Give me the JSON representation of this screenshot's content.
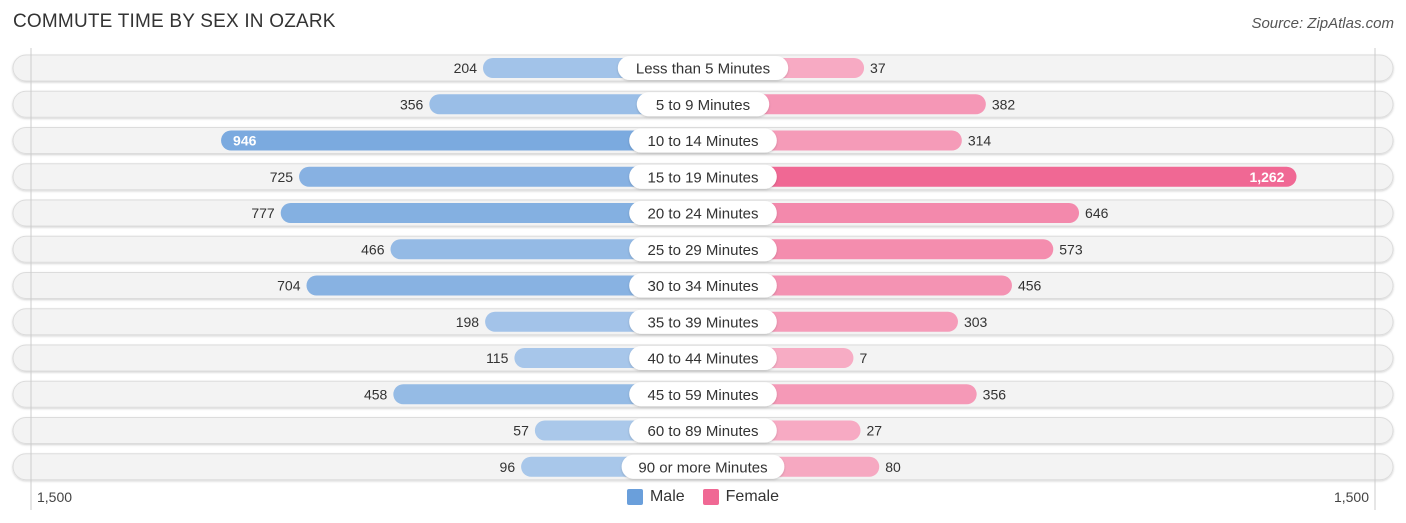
{
  "chart_data": {
    "type": "bar",
    "orientation": "horizontal-diverging",
    "title": "COMMUTE TIME BY SEX IN OZARK",
    "source": "Source: ZipAtlas.com",
    "categories": [
      "Less than 5 Minutes",
      "5 to 9 Minutes",
      "10 to 14 Minutes",
      "15 to 19 Minutes",
      "20 to 24 Minutes",
      "25 to 29 Minutes",
      "30 to 34 Minutes",
      "35 to 39 Minutes",
      "40 to 44 Minutes",
      "45 to 59 Minutes",
      "60 to 89 Minutes",
      "90 or more Minutes"
    ],
    "series": [
      {
        "name": "Male",
        "color": "#6a9fdb",
        "values": [
          204,
          356,
          946,
          725,
          777,
          466,
          704,
          198,
          115,
          458,
          57,
          96
        ],
        "labels": [
          "204",
          "356",
          "946",
          "725",
          "777",
          "466",
          "704",
          "198",
          "115",
          "458",
          "57",
          "96"
        ]
      },
      {
        "name": "Female",
        "color": "#f06894",
        "values": [
          37,
          382,
          314,
          1262,
          646,
          573,
          456,
          303,
          7,
          356,
          27,
          80
        ],
        "labels": [
          "37",
          "382",
          "314",
          "1,262",
          "646",
          "573",
          "456",
          "303",
          "7",
          "356",
          "27",
          "80"
        ]
      }
    ],
    "axis": {
      "left_label": "1,500",
      "right_label": "1,500",
      "max": 1500
    },
    "legend": {
      "position": "bottom-center",
      "items": [
        "Male",
        "Female"
      ]
    }
  }
}
